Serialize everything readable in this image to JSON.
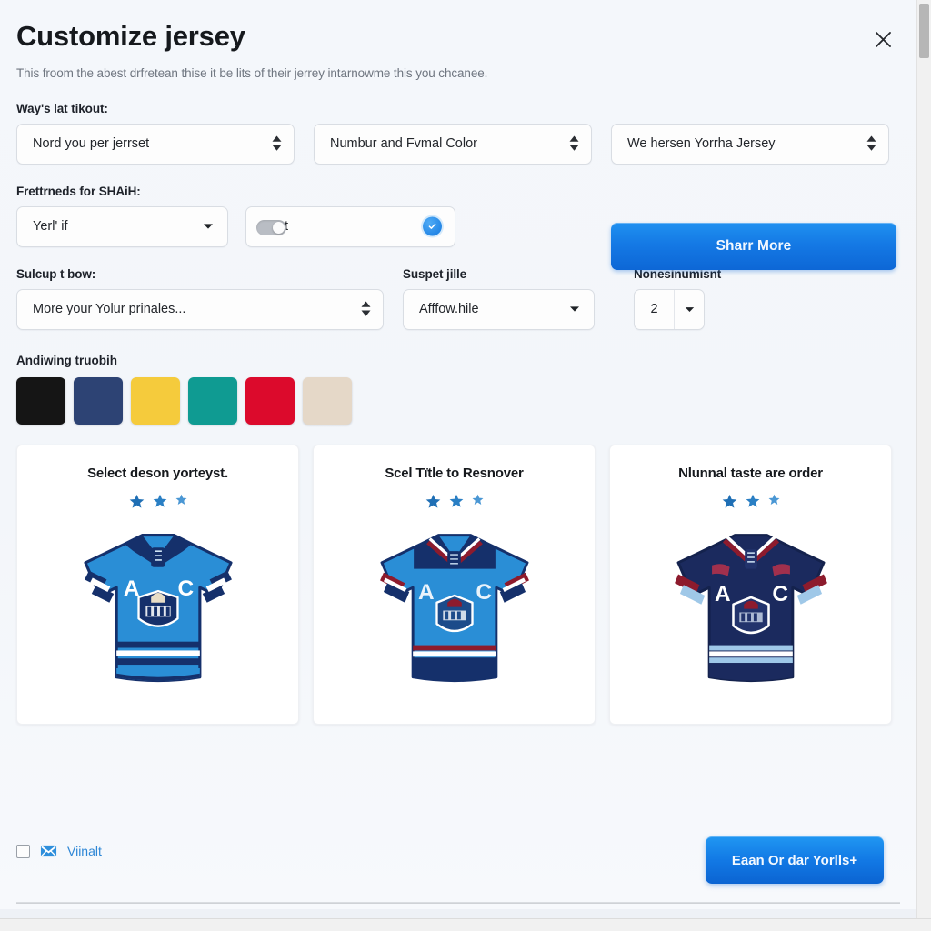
{
  "header": {
    "title": "Customize jersey",
    "subtitle": "This froom the abest drfretean thise it be lits of their jerrey intarnowme this you chcanee.",
    "close_icon": "close-icon"
  },
  "layout_section": {
    "label": "Way's lat tikout:",
    "selects": [
      {
        "value": "Nord you per jerrset",
        "icon": "spinner-icon"
      },
      {
        "value": "Numbur and Fvmal Color",
        "icon": "spinner-icon"
      },
      {
        "value": "We hersen Yorrha Jersey",
        "icon": "spinner-icon"
      }
    ]
  },
  "preferences_section": {
    "label": "Frettrneds for SHAiH:",
    "toggle": {
      "name": "toggle-switch",
      "state": "off"
    },
    "dropdown": {
      "value": "Yerl' if",
      "icon": "chevron-down-icon"
    },
    "text_field": {
      "value": "Wiet",
      "badge_icon": "verified-badge-icon"
    }
  },
  "options_section": {
    "left": {
      "label": "Sulcup t bow:",
      "value": "More your Yolur prinales...",
      "icon": "spinner-icon"
    },
    "middle": {
      "label": "Suspet jille",
      "value": "Afffow.hile",
      "icon": "chevron-down-icon"
    },
    "right": {
      "label": "Nonesinumisnt",
      "value": "2",
      "icon": "chevron-down-icon"
    }
  },
  "swatch_section": {
    "label": "Andiwing truobih",
    "colors": [
      {
        "name": "black",
        "hex": "#151515"
      },
      {
        "name": "navy",
        "hex": "#2d4374"
      },
      {
        "name": "yellow",
        "hex": "#f5cb3c"
      },
      {
        "name": "teal",
        "hex": "#0f9b92"
      },
      {
        "name": "red",
        "hex": "#dc0a2c"
      },
      {
        "name": "beige",
        "hex": "#e5d8c8"
      }
    ]
  },
  "share_button": {
    "label": "Sharr More",
    "accent": "#1478e4"
  },
  "cards": [
    {
      "title": "Select deson yorteyst.",
      "stars": 3,
      "jersey": {
        "name": "light-blue-jersey",
        "body": "#2a8ed6",
        "trim": "#15306b",
        "collar": "#15306b",
        "stripe": "#ffffff",
        "crest_letters": "A C"
      }
    },
    {
      "title": "Scel Tïtle to Resnover",
      "stars": 3,
      "jersey": {
        "name": "blue-navy-jersey",
        "body": "#2a8ed6",
        "trim": "#15306b",
        "collar": "#8d1b2d",
        "stripe": "#ffffff",
        "crest_letters": "A C"
      }
    },
    {
      "title": "Nlunnal taste are order",
      "stars": 3,
      "jersey": {
        "name": "dark-navy-jersey",
        "body": "#1b2a5e",
        "trim": "#8d1b2d",
        "collar": "#8d1b2d",
        "stripe": "#9fc8e8",
        "crest_letters": "A C"
      }
    }
  ],
  "footer": {
    "checkbox": {
      "checked": false
    },
    "mail_icon": "mail-icon",
    "checkbox_label": "Viinalt",
    "order_button": {
      "label": "Eaan Or dar Yorlls+"
    }
  }
}
